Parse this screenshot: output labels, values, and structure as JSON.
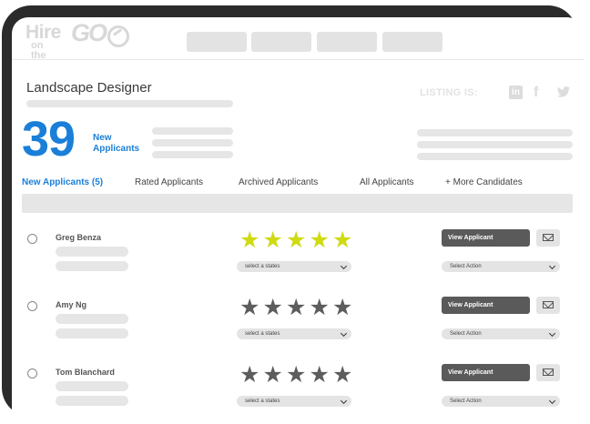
{
  "logo": {
    "word1": "Hire",
    "word2": "on the",
    "word3": "GO"
  },
  "header": {
    "nav_items": [
      "",
      "",
      "",
      ""
    ]
  },
  "job": {
    "title": "Landscape Designer"
  },
  "listing": {
    "label": "LISTING IS:",
    "linkedin": "in",
    "facebook": "f"
  },
  "stats": {
    "count": "39",
    "label_line1": "New",
    "label_line2": "Applicants"
  },
  "tabs": [
    {
      "label": "New Applicants (5)",
      "active": true
    },
    {
      "label": "Rated Applicants",
      "active": false
    },
    {
      "label": "Archived Applicants",
      "active": false
    },
    {
      "label": "All Applicants",
      "active": false
    },
    {
      "label": "+ More Candidates",
      "active": false
    }
  ],
  "applicants": [
    {
      "name": "Greg Benza",
      "rating": 5,
      "rating_placeholder": "select a states",
      "view_label": "View Applicant",
      "action_placeholder": "Select Action"
    },
    {
      "name": "Amy Ng",
      "rating": 0,
      "rating_placeholder": "select a states",
      "view_label": "View Applicant",
      "action_placeholder": "Select Action"
    },
    {
      "name": "Tom Blanchard",
      "rating": 0,
      "rating_placeholder": "select a states",
      "view_label": "View Applicant",
      "action_placeholder": "Select Action"
    }
  ],
  "icons": {
    "star": "★",
    "colors": {
      "accent": "#1a7fd8",
      "star_rated": "#cfdb12",
      "star_unrated": "#5d5d5d",
      "button": "#5a5a5a",
      "frame": "#2b2b2b"
    }
  }
}
